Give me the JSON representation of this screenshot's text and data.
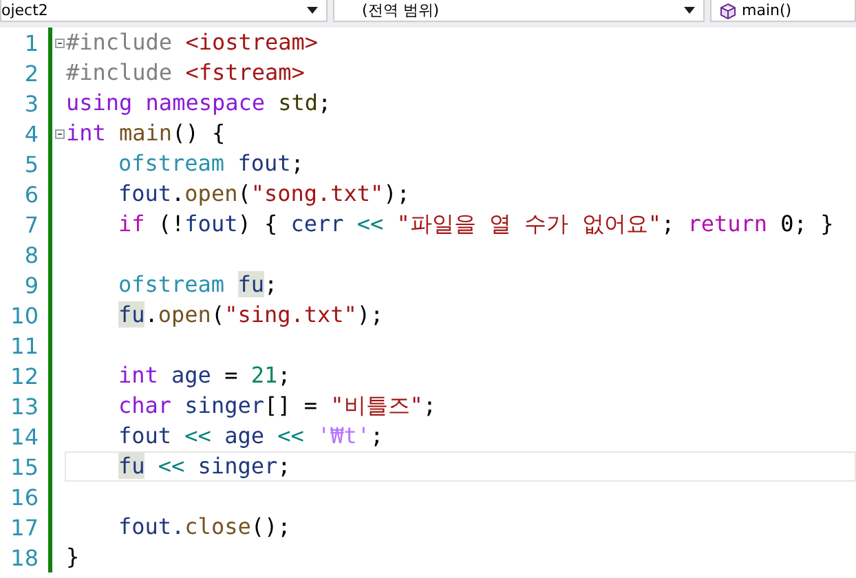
{
  "navigation_bar": {
    "dropdowns": [
      {
        "label": "oject2"
      },
      {
        "label": "(전역 범위)"
      },
      {
        "label": "main()",
        "kind": "function"
      }
    ]
  },
  "editor": {
    "lines": [
      {
        "number": "1",
        "fold": true,
        "current": false,
        "indented": false,
        "tokens": [
          {
            "kind": "pre",
            "t": "#include "
          },
          {
            "kind": "str",
            "t": "<iostream>"
          }
        ]
      },
      {
        "number": "2",
        "fold": false,
        "current": false,
        "indented": false,
        "tokens": [
          {
            "kind": "pre",
            "t": "#include "
          },
          {
            "kind": "str",
            "t": "<fstream>"
          }
        ]
      },
      {
        "number": "3",
        "fold": false,
        "current": false,
        "indented": false,
        "tokens": [
          {
            "kind": "kw",
            "t": "using namespace "
          },
          {
            "kind": "ns",
            "t": "std"
          },
          {
            "kind": "p",
            "t": ";"
          }
        ]
      },
      {
        "number": "4",
        "fold": true,
        "current": false,
        "indented": false,
        "tokens": [
          {
            "kind": "kw",
            "t": "int "
          },
          {
            "kind": "fn",
            "t": "main"
          },
          {
            "kind": "p",
            "t": "() {"
          }
        ]
      },
      {
        "number": "5",
        "fold": false,
        "current": false,
        "indented": true,
        "tokens": [
          {
            "kind": "type",
            "t": "ofstream "
          },
          {
            "kind": "var",
            "t": "fout"
          },
          {
            "kind": "p",
            "t": ";"
          }
        ]
      },
      {
        "number": "6",
        "fold": false,
        "current": false,
        "indented": true,
        "tokens": [
          {
            "kind": "var",
            "t": "fout"
          },
          {
            "kind": "p",
            "t": "."
          },
          {
            "kind": "fn",
            "t": "open"
          },
          {
            "kind": "p",
            "t": "("
          },
          {
            "kind": "str",
            "t": "\"song.txt\""
          },
          {
            "kind": "p",
            "t": ");"
          }
        ]
      },
      {
        "number": "7",
        "fold": false,
        "current": false,
        "indented": true,
        "tokens": [
          {
            "kind": "ctl",
            "t": "if"
          },
          {
            "kind": "p",
            "t": " (!"
          },
          {
            "kind": "var",
            "t": "fout"
          },
          {
            "kind": "p",
            "t": ") { "
          },
          {
            "kind": "var",
            "t": "cerr"
          },
          {
            "kind": "op",
            "t": " << "
          },
          {
            "kind": "str",
            "t": "\"파일을 열 수가 없어요\""
          },
          {
            "kind": "p",
            "t": "; "
          },
          {
            "kind": "ctl",
            "t": "return"
          },
          {
            "kind": "p",
            "t": " 0; }"
          }
        ]
      },
      {
        "number": "8",
        "fold": false,
        "current": false
      },
      {
        "number": "9",
        "fold": false,
        "current": false,
        "indented": true,
        "tokens": [
          {
            "kind": "type",
            "t": "ofstream "
          },
          {
            "kind": "var",
            "t": "fu",
            "highlighted": true
          },
          {
            "kind": "p",
            "t": ";"
          }
        ]
      },
      {
        "number": "10",
        "fold": false,
        "current": false,
        "indented": true,
        "tokens": [
          {
            "kind": "var",
            "t": "fu",
            "highlighted": true
          },
          {
            "kind": "p",
            "t": "."
          },
          {
            "kind": "fn",
            "t": "open"
          },
          {
            "kind": "p",
            "t": "("
          },
          {
            "kind": "str",
            "t": "\"sing.txt\""
          },
          {
            "kind": "p",
            "t": ");"
          }
        ]
      },
      {
        "number": "11",
        "fold": false,
        "current": false
      },
      {
        "number": "12",
        "fold": false,
        "current": false,
        "indented": true,
        "tokens": [
          {
            "kind": "kw",
            "t": "int "
          },
          {
            "kind": "var",
            "t": "age"
          },
          {
            "kind": "p",
            "t": " = "
          },
          {
            "kind": "num",
            "t": "21"
          },
          {
            "kind": "p",
            "t": ";"
          }
        ]
      },
      {
        "number": "13",
        "fold": false,
        "current": false,
        "indented": true,
        "tokens": [
          {
            "kind": "kw",
            "t": "char "
          },
          {
            "kind": "var",
            "t": "singer"
          },
          {
            "kind": "p",
            "t": "[] = "
          },
          {
            "kind": "str",
            "t": "\"비틀즈\""
          },
          {
            "kind": "p",
            "t": ";"
          }
        ]
      },
      {
        "number": "14",
        "fold": false,
        "current": false,
        "indented": true,
        "tokens": [
          {
            "kind": "var",
            "t": "fout"
          },
          {
            "kind": "op",
            "t": " << "
          },
          {
            "kind": "var",
            "t": "age"
          },
          {
            "kind": "op",
            "t": " << "
          },
          {
            "kind": "esc",
            "t": "'₩t'"
          },
          {
            "kind": "p",
            "t": ";"
          }
        ]
      },
      {
        "number": "15",
        "fold": false,
        "current": true,
        "indented": true,
        "tokens": [
          {
            "kind": "var",
            "t": "fu",
            "highlighted": true
          },
          {
            "kind": "op",
            "t": " << "
          },
          {
            "kind": "var",
            "t": "singer"
          },
          {
            "kind": "p",
            "t": ";"
          }
        ]
      },
      {
        "number": "16",
        "fold": false,
        "current": false
      },
      {
        "number": "17",
        "fold": false,
        "current": false,
        "indented": true,
        "tokens": [
          {
            "kind": "var",
            "t": "fout."
          },
          {
            "kind": "fn",
            "t": "close"
          },
          {
            "kind": "p",
            "t": "();"
          }
        ]
      },
      {
        "number": "18",
        "fold": false,
        "current": false,
        "indented": false,
        "tokens": [
          {
            "kind": "p",
            "t": "}"
          }
        ]
      }
    ]
  }
}
